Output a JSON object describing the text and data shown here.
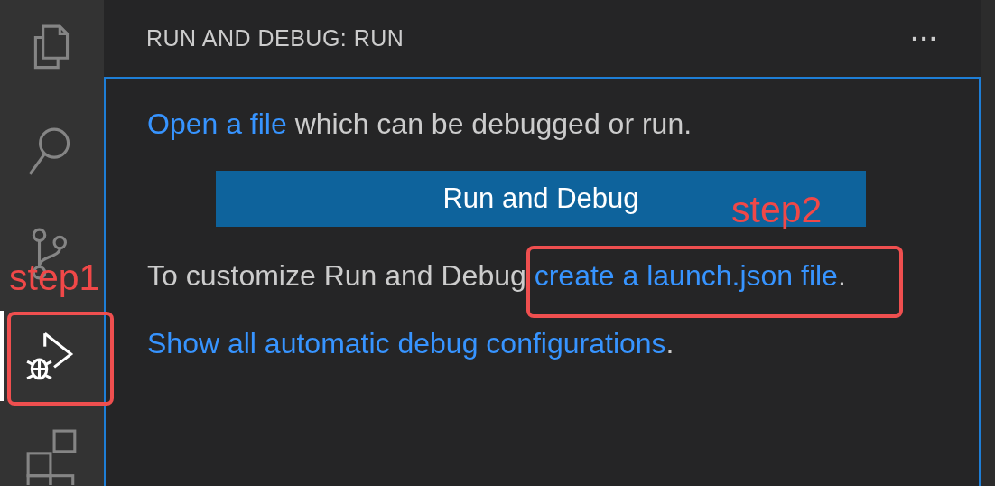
{
  "activity_bar": {
    "items": [
      {
        "kind": "files",
        "selected": false
      },
      {
        "kind": "search",
        "selected": false
      },
      {
        "kind": "source-control",
        "selected": false
      },
      {
        "kind": "run-debug",
        "selected": true
      },
      {
        "kind": "extensions",
        "selected": false
      }
    ]
  },
  "sidebar": {
    "title": "RUN AND DEBUG: RUN",
    "more": "···",
    "content": [
      {
        "kind": "paragraph",
        "segments": [
          {
            "text": "Open a file",
            "link": true
          },
          {
            "text": " which can be debugged or run.",
            "link": false
          }
        ]
      },
      {
        "kind": "button",
        "label": "Run and Debug"
      },
      {
        "kind": "paragraph",
        "segments": [
          {
            "text": "To customize Run and Debug ",
            "link": false
          },
          {
            "text": "create a launch.json file",
            "link": true
          },
          {
            "text": ".",
            "link": false
          }
        ]
      },
      {
        "kind": "paragraph",
        "segments": [
          {
            "text": "Show all automatic debug configurations",
            "link": true
          },
          {
            "text": ".",
            "link": false
          }
        ]
      }
    ]
  },
  "annotations": [
    {
      "kind": "label",
      "text": "step1"
    },
    {
      "kind": "box"
    },
    {
      "kind": "label",
      "text": "step2"
    },
    {
      "kind": "box"
    }
  ]
}
